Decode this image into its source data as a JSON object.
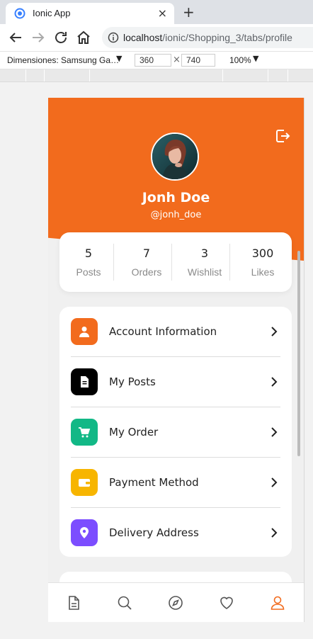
{
  "browser": {
    "tab_title": "Ionic App",
    "close_symbol": "×",
    "new_tab_symbol": "+",
    "url_host": "localhost",
    "url_path": "/ionic/Shopping_3/tabs/profile"
  },
  "devtools": {
    "device_label": "Dimensiones: Samsung Ga…",
    "width": "360",
    "height": "740",
    "times_symbol": "×",
    "zoom": "100%"
  },
  "profile": {
    "name": "Jonh Doe",
    "handle": "@jonh_doe",
    "stats": [
      {
        "value": "5",
        "label": "Posts"
      },
      {
        "value": "7",
        "label": "Orders"
      },
      {
        "value": "3",
        "label": "Wishlist"
      },
      {
        "value": "300",
        "label": "Likes"
      }
    ]
  },
  "menu": [
    {
      "label": "Account Information",
      "icon": "user-icon",
      "color": "#f26b1d"
    },
    {
      "label": "My Posts",
      "icon": "document-icon",
      "color": "#000000"
    },
    {
      "label": "My Order",
      "icon": "cart-icon",
      "color": "#12b886"
    },
    {
      "label": "Payment Method",
      "icon": "wallet-icon",
      "color": "#f7b500"
    },
    {
      "label": "Delivery Address",
      "icon": "location-icon",
      "color": "#7c4dff"
    }
  ],
  "tabs": [
    {
      "name": "posts",
      "icon": "document-icon",
      "active": false
    },
    {
      "name": "search",
      "icon": "search-icon",
      "active": false
    },
    {
      "name": "explore",
      "icon": "compass-icon",
      "active": false
    },
    {
      "name": "wishlist",
      "icon": "heart-icon",
      "active": false
    },
    {
      "name": "profile",
      "icon": "person-icon",
      "active": true
    }
  ],
  "colors": {
    "accent": "#f26b1d",
    "tab_inactive": "#555555"
  }
}
